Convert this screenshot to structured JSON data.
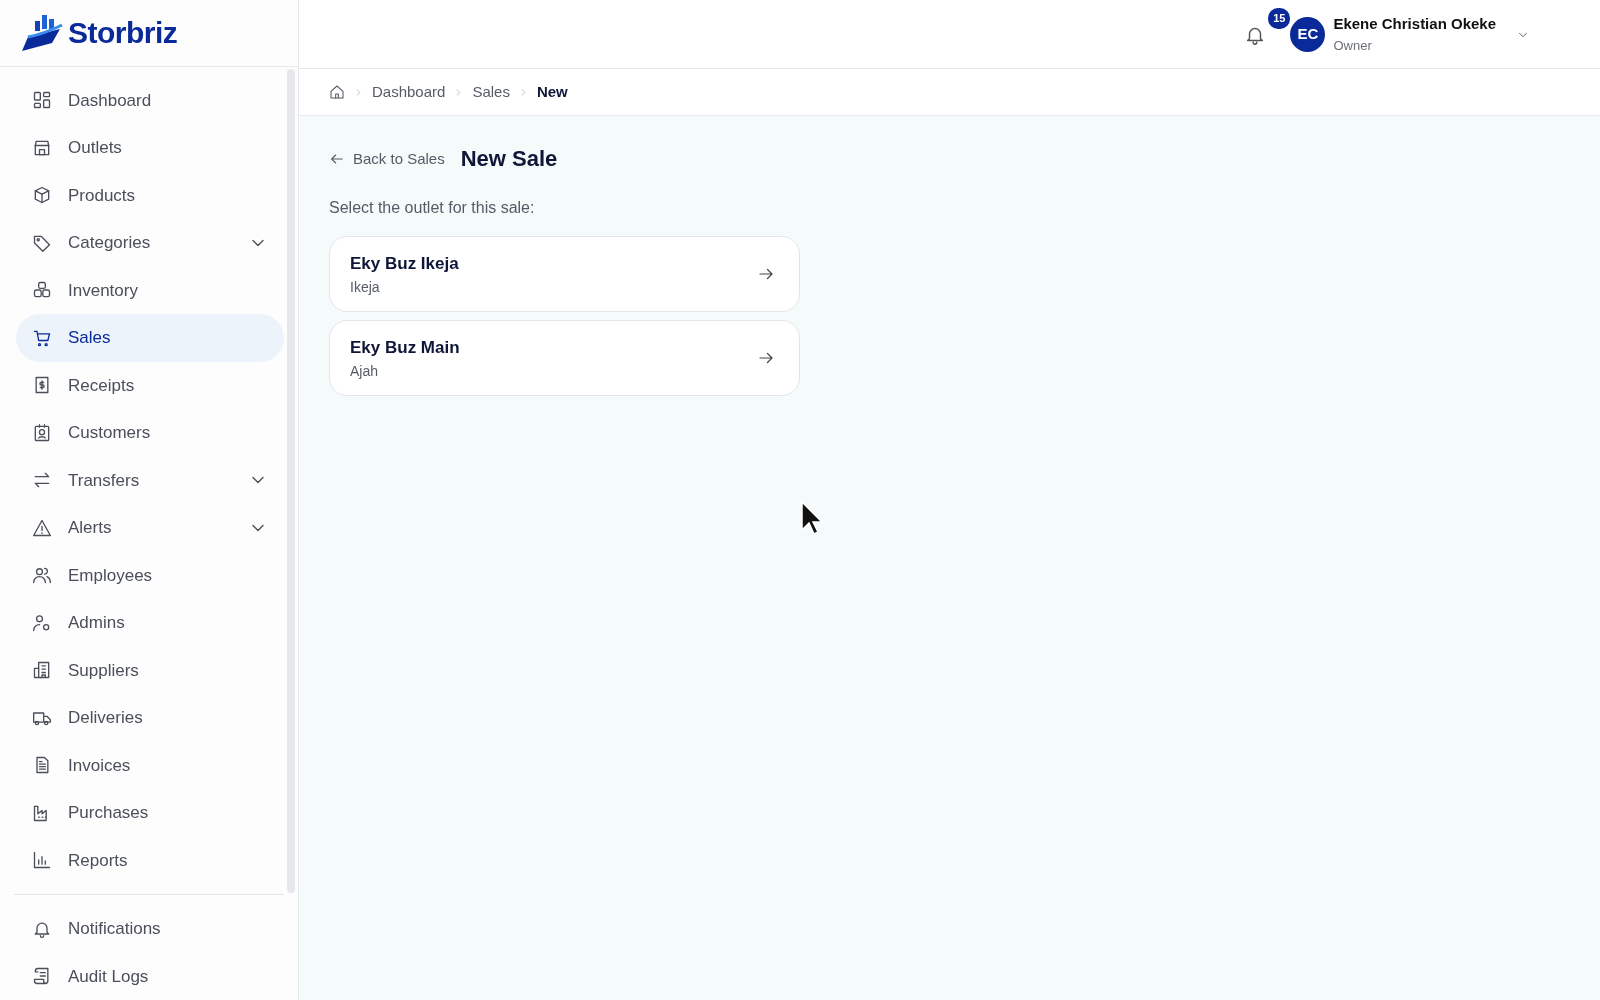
{
  "brand": {
    "name": "Storbriz"
  },
  "sidebar": {
    "items": [
      {
        "label": "Dashboard",
        "selected": false,
        "expandable": false
      },
      {
        "label": "Outlets",
        "selected": false,
        "expandable": false
      },
      {
        "label": "Products",
        "selected": false,
        "expandable": false
      },
      {
        "label": "Categories",
        "selected": false,
        "expandable": true
      },
      {
        "label": "Inventory",
        "selected": false,
        "expandable": false
      },
      {
        "label": "Sales",
        "selected": true,
        "expandable": false
      },
      {
        "label": "Receipts",
        "selected": false,
        "expandable": false
      },
      {
        "label": "Customers",
        "selected": false,
        "expandable": false
      },
      {
        "label": "Transfers",
        "selected": false,
        "expandable": true
      },
      {
        "label": "Alerts",
        "selected": false,
        "expandable": true
      },
      {
        "label": "Employees",
        "selected": false,
        "expandable": false
      },
      {
        "label": "Admins",
        "selected": false,
        "expandable": false
      },
      {
        "label": "Suppliers",
        "selected": false,
        "expandable": false
      },
      {
        "label": "Deliveries",
        "selected": false,
        "expandable": false
      },
      {
        "label": "Invoices",
        "selected": false,
        "expandable": false
      },
      {
        "label": "Purchases",
        "selected": false,
        "expandable": false
      },
      {
        "label": "Reports",
        "selected": false,
        "expandable": false
      }
    ],
    "footer_items": [
      {
        "label": "Notifications",
        "selected": false
      },
      {
        "label": "Audit Logs",
        "selected": false
      }
    ]
  },
  "header": {
    "notification_count": "15",
    "user": {
      "initials": "EC",
      "name": "Ekene Christian Okeke",
      "role": "Owner"
    }
  },
  "breadcrumb": [
    "Dashboard",
    "Sales",
    "New"
  ],
  "page": {
    "back_link": "Back to Sales",
    "title": "New Sale",
    "prompt": "Select the outlet for this sale:",
    "outlets": [
      {
        "name": "Eky Buz Ikeja",
        "location": "Ikeja"
      },
      {
        "name": "Eky Buz Main",
        "location": "Ajah"
      }
    ]
  }
}
